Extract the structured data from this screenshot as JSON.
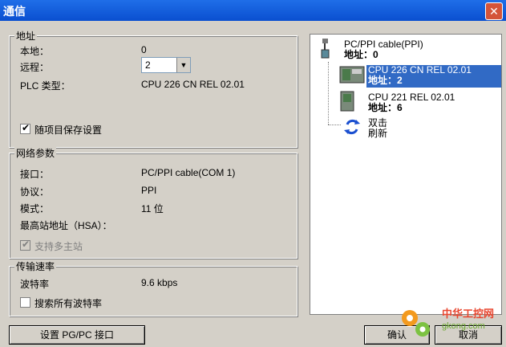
{
  "window": {
    "title": "通信"
  },
  "address_group": {
    "title": "地址",
    "local_label": "本地：",
    "local_value": "0",
    "remote_label": "远程：",
    "remote_value": "2",
    "plc_type_label": "PLC 类型：",
    "plc_type_value": "CPU 226 CN REL 02.01",
    "save_with_project_label": "随项目保存设置",
    "save_with_project_checked": true
  },
  "network_group": {
    "title": "网络参数",
    "interface_label": "接口：",
    "interface_value": "PC/PPI cable(COM 1)",
    "protocol_label": "协议：",
    "protocol_value": "PPI",
    "mode_label": "模式：",
    "mode_value": "11 位",
    "hsa_label": "最高站地址（HSA）：",
    "multi_master_label": "支持多主站",
    "multi_master_checked": true
  },
  "baud_group": {
    "title": "传输速率",
    "baud_label": "波特率",
    "baud_value": "9.6 kbps",
    "search_all_label": "搜索所有波特率",
    "search_all_checked": false
  },
  "tree": {
    "cable": {
      "name": "PC/PPI cable(PPI)",
      "address": "地址：0"
    },
    "devices": [
      {
        "name": "CPU 226 CN REL 02.01",
        "address": "地址：2",
        "selected": true
      },
      {
        "name": "CPU 221 REL 02.01",
        "address": "地址：6",
        "selected": false
      }
    ],
    "refresh": {
      "line1": "双击",
      "line2": "刷新"
    }
  },
  "buttons": {
    "set_pgpc": "设置 PG/PC 接口",
    "ok": "确认",
    "cancel": "取消"
  },
  "watermark": {
    "text1": "中华工控网",
    "text2": "gkong.com"
  },
  "colors": {
    "titlebar": "#0a4fd0",
    "selection": "#316ac5",
    "face": "#d4d0c8"
  }
}
